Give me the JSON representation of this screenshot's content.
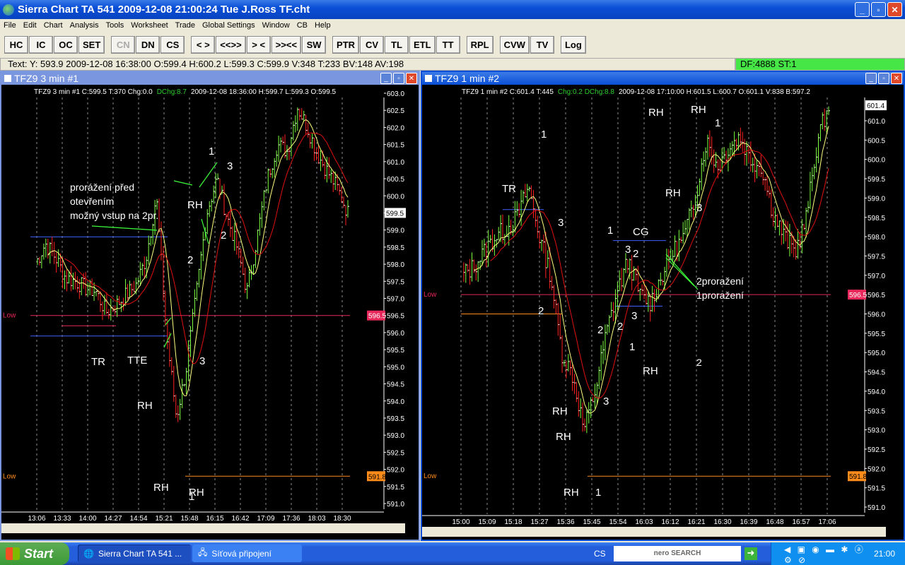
{
  "app": {
    "title": "Sierra Chart TA 541  2009-12-08  21:00:24  Tue   J.Ross TF.cht"
  },
  "menu": [
    "File",
    "Edit",
    "Chart",
    "Analysis",
    "Tools",
    "Worksheet",
    "Trade",
    "Global Settings",
    "Window",
    "CB",
    "Help"
  ],
  "toolbar": [
    "HC",
    "IC",
    "OC",
    "SET",
    "CN",
    "DN",
    "CS",
    "< >",
    "<<>>",
    "> <",
    ">><<",
    "SW",
    "PTR",
    "CV",
    "TL",
    "ETL",
    "TT",
    "RPL",
    "CVW",
    "TV",
    "Log"
  ],
  "status": {
    "text": "Text: Y: 593.9  2009-12-08  16:38:00  O:599.4  H:600.2  L:599.3  C:599.9  V:348  T:233  BV:148  AV:198",
    "feed": "DF:4888  ST:1"
  },
  "colors": {
    "up": "#7cff40",
    "down": "#ff2020",
    "ma_fast": "#ffff80",
    "ma_slow": "#e01010",
    "level": "#e8285a",
    "low": "#ff8c1a",
    "blue": "#4060ff"
  },
  "left": {
    "title": "TFZ9  3 min   #1",
    "info": {
      "sym": "TFZ9  3 min   #1  C:599.5  T:370  Chg:0.0",
      "dchg": "DChg:8.7",
      "rest": "2009-12-08   18:36:00  H:599.7  L:599.3  O:599.5"
    },
    "price_range": [
      591.0,
      603.0
    ],
    "price_ticks": [
      "591.0",
      "591.5",
      "592.0",
      "592.5",
      "593.0",
      "593.5",
      "594.0",
      "594.5",
      "595.0",
      "595.5",
      "596.0",
      "596.5",
      "597.0",
      "597.5",
      "598.0",
      "598.5",
      "599.0",
      "599.5",
      "600.0",
      "600.5",
      "601.0",
      "601.5",
      "602.0",
      "602.5",
      "603.0"
    ],
    "time_ticks": [
      "13:06",
      "13:33",
      "14:00",
      "14:27",
      "14:54",
      "15:21",
      "15:48",
      "16:15",
      "16:42",
      "17:09",
      "17:36",
      "18:03",
      "18:30"
    ],
    "last_price": "599.5",
    "level_label": "596.5",
    "low_label": "591.8",
    "low_text": "Low",
    "prices": [
      598,
      598.6,
      598.2,
      597.6,
      597.5,
      597.3,
      597.2,
      596.6,
      596.8,
      597.1,
      597.4,
      598.2,
      600.0,
      596.0,
      593.5,
      595.0,
      597.2,
      599.5,
      600.5,
      599.4,
      598.5,
      597.2,
      598.8,
      600.5,
      601.5,
      601.3,
      602.6,
      602.0,
      601.2,
      600.7,
      600.2,
      599.5
    ],
    "annotations": [
      "prorážení před",
      "otevřením",
      "možný vstup na 2pr.",
      "TR",
      "TTE",
      "RH",
      "RH",
      "RH",
      "1",
      "2",
      "2",
      "3",
      "3",
      "1",
      "RH"
    ]
  },
  "right": {
    "title": "TFZ9  1 min   #2",
    "info": {
      "sym": "TFZ9  1 min   #2  C:601.4  T:445",
      "chg": "Chg:0.2  DChg:8.8",
      "rest": "2009-12-08   17:10:00  H:601.5  L:600.7  O:601.1  V:838  B:597.2"
    },
    "price_range": [
      591.0,
      601.0
    ],
    "price_ticks": [
      "591.0",
      "591.5",
      "592.0",
      "592.5",
      "593.0",
      "593.5",
      "594.0",
      "594.5",
      "595.0",
      "595.5",
      "596.0",
      "596.5",
      "597.0",
      "597.5",
      "598.0",
      "598.5",
      "599.0",
      "599.5",
      "600.0",
      "600.5",
      "601.0"
    ],
    "time_ticks": [
      "15:00",
      "15:09",
      "15:18",
      "15:27",
      "15:36",
      "15:45",
      "15:54",
      "16:03",
      "16:12",
      "16:21",
      "16:30",
      "16:39",
      "16:48",
      "16:57",
      "17:06"
    ],
    "last_price": "601.4",
    "level_label": "596.5",
    "low_label": "591.8",
    "low_text": "Low",
    "prices": [
      597.0,
      597.2,
      597.6,
      598.0,
      598.2,
      598.5,
      599.3,
      598.0,
      597.0,
      595.0,
      594.4,
      593.0,
      594.0,
      595.5,
      596.6,
      597.4,
      596.5,
      596.3,
      597.0,
      597.6,
      598.0,
      599.0,
      600.5,
      599.8,
      600.3,
      600.6,
      600.0,
      599.8,
      598.6,
      598.0,
      597.6,
      598.5,
      600.5,
      601.4
    ],
    "annotations": [
      "1",
      "TR",
      "3",
      "2",
      "RH",
      "RH",
      "RH",
      "1",
      "2",
      "3",
      "1",
      "CG",
      "3",
      "2",
      "2",
      "3",
      "RH",
      "1",
      "RH",
      "RH",
      "RH",
      "1",
      "3",
      "2",
      "2proražení",
      "1proražení"
    ]
  },
  "taskbar": {
    "start": "Start",
    "tasks": [
      "Sierra Chart TA 541 ...",
      "Síťová připojení"
    ],
    "lang": "CS",
    "search": "nero SEARCH",
    "clock": "21:00"
  }
}
